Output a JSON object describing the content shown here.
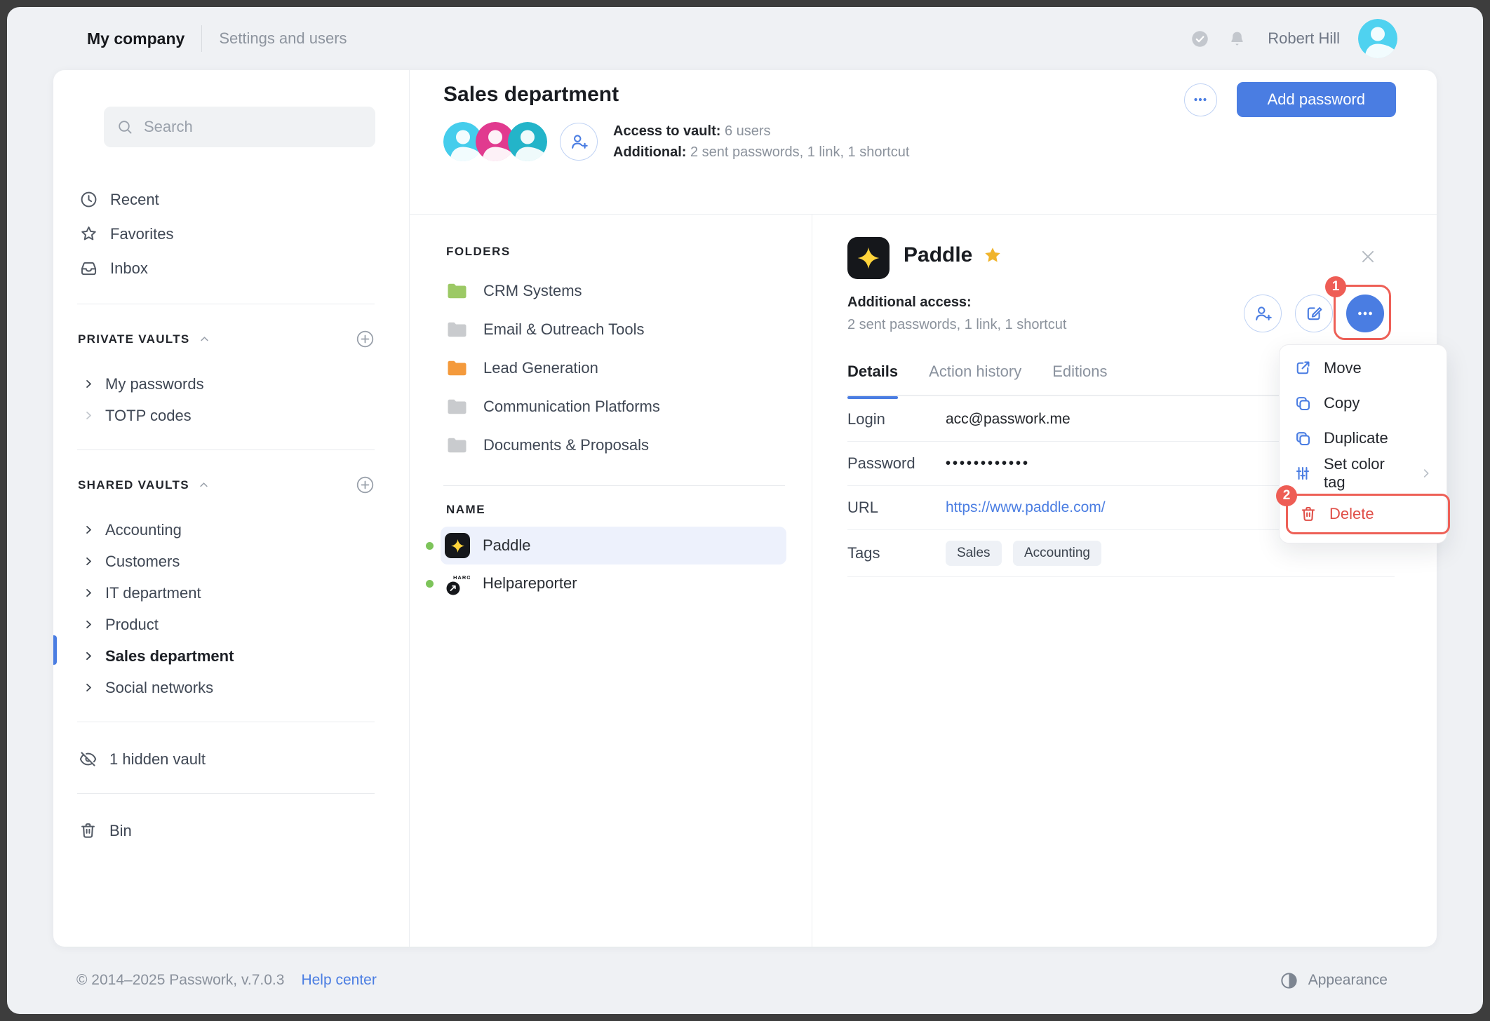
{
  "topbar": {
    "company": "My company",
    "nav": "Settings and users",
    "user_name": "Robert Hill"
  },
  "sidebar": {
    "search_placeholder": "Search",
    "nav": [
      {
        "label": "Recent"
      },
      {
        "label": "Favorites"
      },
      {
        "label": "Inbox"
      }
    ],
    "private_title": "PRIVATE VAULTS",
    "private_items": [
      {
        "label": "My passwords"
      },
      {
        "label": "TOTP codes"
      }
    ],
    "shared_title": "SHARED VAULTS",
    "shared_items": [
      {
        "label": "Accounting"
      },
      {
        "label": "Customers"
      },
      {
        "label": "IT department"
      },
      {
        "label": "Product"
      },
      {
        "label": "Sales department"
      },
      {
        "label": "Social networks"
      }
    ],
    "active_item": "Sales department",
    "hidden_vault": "1 hidden vault",
    "bin": "Bin"
  },
  "header": {
    "title": "Sales department",
    "access_label": "Access to vault:",
    "access_value": "6 users",
    "additional_label": "Additional:",
    "additional_value": "2 sent passwords, 1 link, 1 shortcut",
    "add_password_label": "Add password"
  },
  "folders": {
    "title": "FOLDERS",
    "items": [
      {
        "name": "CRM Systems",
        "color": "#9cc965"
      },
      {
        "name": "Email & Outreach Tools",
        "color": "#c9cbce"
      },
      {
        "name": "Lead Generation",
        "color": "#f49a3c"
      },
      {
        "name": "Communication Platforms",
        "color": "#c9cbce"
      },
      {
        "name": "Documents & Proposals",
        "color": "#c9cbce"
      }
    ]
  },
  "records": {
    "title": "NAME",
    "items": [
      {
        "name": "Paddle"
      },
      {
        "name": "Helpareporter"
      }
    ]
  },
  "detail": {
    "title": "Paddle",
    "additional_access_label": "Additional access:",
    "additional_access_value": "2 sent passwords, 1 link, 1 shortcut",
    "tabs": [
      {
        "label": "Details"
      },
      {
        "label": "Action history"
      },
      {
        "label": "Editions"
      }
    ],
    "fields": {
      "login_label": "Login",
      "login_value": "acc@passwork.me",
      "password_label": "Password",
      "password_value": "••••••••••••",
      "url_label": "URL",
      "url_value": "https://www.paddle.com/",
      "tags_label": "Tags",
      "tags": [
        "Sales",
        "Accounting"
      ]
    }
  },
  "menu": {
    "move": "Move",
    "copy": "Copy",
    "duplicate": "Duplicate",
    "set_color_tag": "Set color tag",
    "delete": "Delete"
  },
  "annotations": {
    "step_1": "1",
    "step_2": "2"
  },
  "footer": {
    "copyright": "© 2014–2025 Passwork, v.7.0.3",
    "help": "Help center",
    "appearance": "Appearance"
  },
  "colors": {
    "accent_blue": "#4a7de2",
    "annotation_red": "#ee5d55",
    "delete_red": "#e04f48",
    "status_green": "#7dc45a",
    "selected_row_bg": "#edf1fc",
    "paddle_star_yellow": "#ffd43b",
    "favorite_star_gold": "#f0b42c",
    "avatars": [
      "#45cdec",
      "#e13a8f",
      "#23b4c9"
    ],
    "topbar_avatar": "#4fd2f0"
  }
}
